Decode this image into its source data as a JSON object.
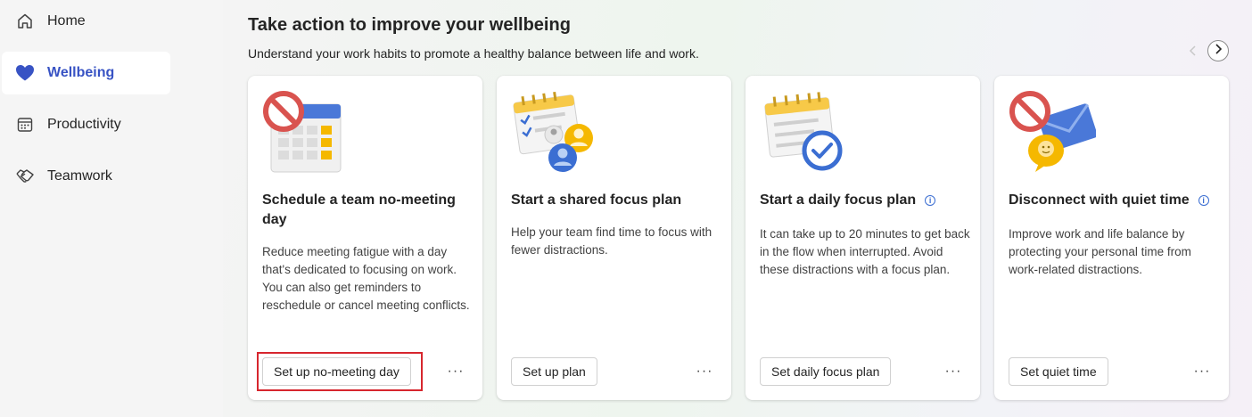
{
  "sidebar": {
    "items": [
      {
        "label": "Home",
        "icon": "home-icon",
        "active": false
      },
      {
        "label": "Wellbeing",
        "icon": "heart-icon",
        "active": true
      },
      {
        "label": "Productivity",
        "icon": "calendar-icon",
        "active": false
      },
      {
        "label": "Teamwork",
        "icon": "handshake-icon",
        "active": false
      }
    ]
  },
  "main": {
    "title": "Take action to improve your wellbeing",
    "subtitle": "Understand your work habits to promote a healthy balance between life and work.",
    "cards": [
      {
        "title": "Schedule a team no-meeting day",
        "description": "Reduce meeting fatigue with a day that's dedicated to focusing on work. You can also get reminders to reschedule or cancel meeting conflicts.",
        "button": "Set up no-meeting day",
        "more": "···",
        "icon": "no-meeting-calendar-icon"
      },
      {
        "title": "Start a shared focus plan",
        "description": "Help your team find time to focus with fewer distractions.",
        "button": "Set up plan",
        "more": "···",
        "icon": "shared-focus-icon"
      },
      {
        "title": "Start a daily focus plan",
        "description": "It can take up to 20 minutes to get back in the flow when interrupted. Avoid these distractions with a focus plan.",
        "button": "Set daily focus plan",
        "more": "···",
        "icon": "daily-focus-icon"
      },
      {
        "title": "Disconnect with quiet time",
        "description": "Improve work and life balance by protecting your personal time from work-related distractions.",
        "button": "Set quiet time",
        "more": "···",
        "icon": "quiet-time-icon"
      }
    ]
  },
  "colors": {
    "accent": "#3853c4",
    "highlight": "#d7262e",
    "no_sign": "#d9534f"
  }
}
